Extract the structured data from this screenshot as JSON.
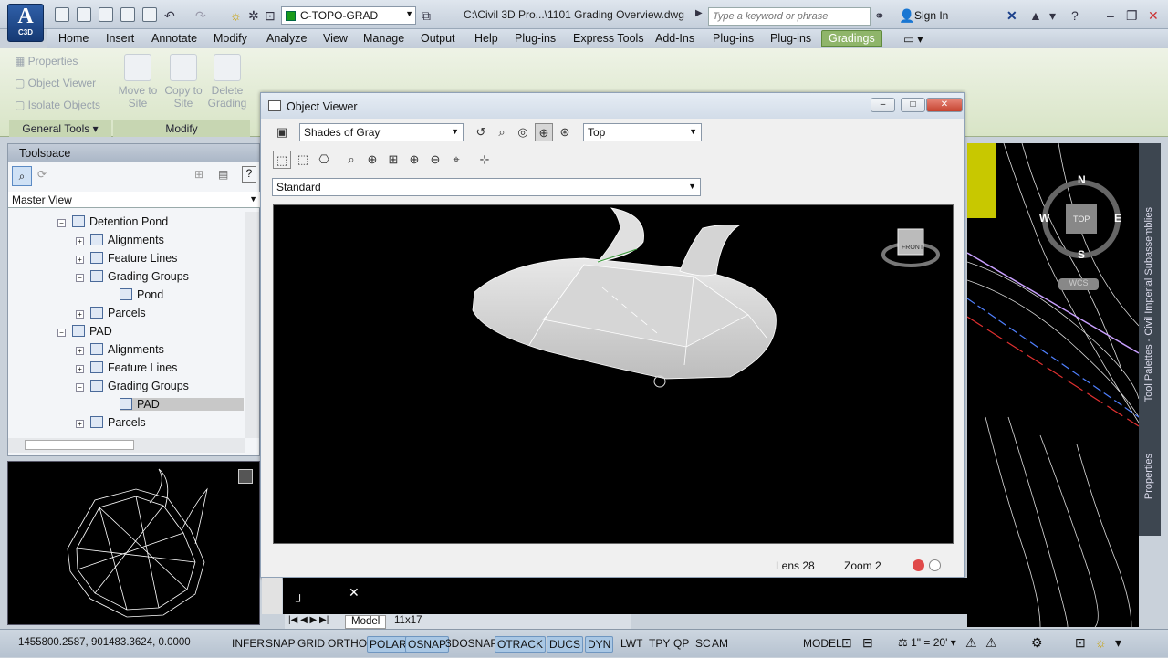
{
  "app": {
    "logo": "A",
    "logo_sub": "C3D"
  },
  "titlebar": {
    "layer": "C-TOPO-GRAD",
    "layer_color": "#1a9a1a",
    "doc_title": "C:\\Civil 3D Pro...\\1101 Grading Overview.dwg",
    "search_placeholder": "Type a keyword or phrase",
    "signin": "Sign In"
  },
  "menu": [
    "Home",
    "Insert",
    "Annotate",
    "Modify",
    "Analyze",
    "View",
    "Manage",
    "Output",
    "Help",
    "Plug-ins",
    "Express Tools",
    "Add-Ins",
    "Plug-ins",
    "Plug-ins"
  ],
  "menu_active": "Gradings",
  "ribbon": {
    "general_tools": [
      "Properties",
      "Object Viewer",
      "Isolate Objects"
    ],
    "general_title": "General Tools",
    "modify_buttons": [
      [
        "Move to",
        "Site"
      ],
      [
        "Copy to",
        "Site"
      ],
      [
        "Delete",
        "Grading"
      ]
    ],
    "modify_title": "Modify"
  },
  "toolspace": {
    "title": "Toolspace",
    "view": "Master View",
    "tree": [
      {
        "label": "Detention Pond",
        "depth": 0
      },
      {
        "label": "Alignments",
        "depth": 1
      },
      {
        "label": "Feature Lines",
        "depth": 1
      },
      {
        "label": "Grading Groups",
        "depth": 1
      },
      {
        "label": "Pond",
        "depth": 2
      },
      {
        "label": "Parcels",
        "depth": 1
      },
      {
        "label": "PAD",
        "depth": 0
      },
      {
        "label": "Alignments",
        "depth": 1
      },
      {
        "label": "Feature Lines",
        "depth": 1
      },
      {
        "label": "Grading Groups",
        "depth": 1
      },
      {
        "label": "PAD",
        "depth": 2,
        "selected": true
      },
      {
        "label": "Parcels",
        "depth": 1
      }
    ]
  },
  "object_viewer": {
    "title": "Object Viewer",
    "visual_style": "Shades of Gray",
    "view": "Top",
    "named_view": "Standard",
    "lens": "Lens 28",
    "zoom": "Zoom 2"
  },
  "viewcube": {
    "n": "N",
    "s": "S",
    "e": "E",
    "w": "W",
    "top": "TOP",
    "wcs": "WCS",
    "front": "FRONT"
  },
  "right_palette": [
    "Tool Palettes - Civil Imperial Subassemblies",
    "Properties"
  ],
  "layout_tabs": [
    "Model",
    "11x17"
  ],
  "statusbar": {
    "coords": "1455800.2587, 901483.3624, 0.0000",
    "toggles": [
      {
        "label": "INFER",
        "on": false
      },
      {
        "label": "SNAP",
        "on": false
      },
      {
        "label": "GRID",
        "on": false
      },
      {
        "label": "ORTHO",
        "on": false
      },
      {
        "label": "POLAR",
        "on": true
      },
      {
        "label": "OSNAP",
        "on": true
      },
      {
        "label": "3DOSNAP",
        "on": false
      },
      {
        "label": "OTRACK",
        "on": true
      },
      {
        "label": "DUCS",
        "on": true
      },
      {
        "label": "DYN",
        "on": true
      },
      {
        "label": "LWT",
        "on": false
      },
      {
        "label": "TPY",
        "on": false
      },
      {
        "label": "QP",
        "on": false
      },
      {
        "label": "SC",
        "on": false
      },
      {
        "label": "AM",
        "on": false
      }
    ],
    "model": "MODEL",
    "scale": "1\" = 20'"
  }
}
